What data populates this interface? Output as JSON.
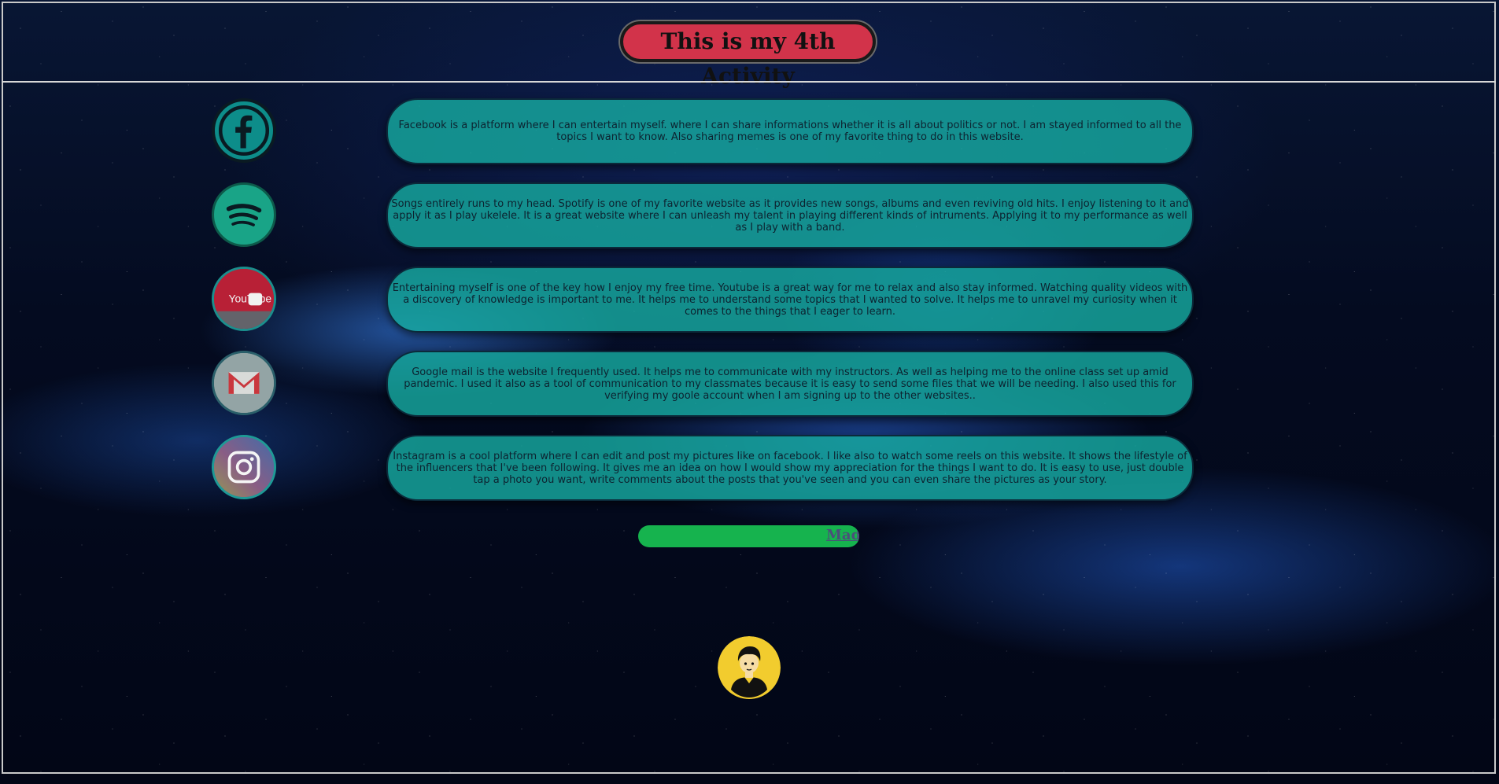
{
  "header": {
    "title": "This is my 4th Activity"
  },
  "sites": [
    {
      "name": "Facebook",
      "icon": "facebook-icon",
      "description": "Facebook is a platform where I can entertain myself. where I can share informations whether it is all about politics or not. I am stayed informed to all the topics I want to know. Also sharing memes is one of my favorite thing to do in this website."
    },
    {
      "name": "Spotify",
      "icon": "spotify-icon",
      "description": "Songs entirely runs to my head. Spotify is one of my favorite website as it provides new songs, albums and even reviving old hits. I enjoy listening to it and apply it as I play ukelele. It is a great website where I can unleash my talent in playing different kinds of intruments. Applying it to my performance as well as I play with a band."
    },
    {
      "name": "YouTube",
      "icon": "youtube-icon",
      "icon_text": "YouTube",
      "description": "Entertaining myself is one of the key how I enjoy my free time. Youtube is a great way for me to relax and also stay informed. Watching quality videos with a discovery of knowledge is important to me. It helps me to understand some topics that I wanted to solve. It helps me to unravel my curiosity when it comes to the things that I eager to learn."
    },
    {
      "name": "Gmail",
      "icon": "gmail-icon",
      "description": "Google mail is the website I frequently used. It helps me to communicate with my instructors. As well as helping me to the online class set up amid pandemic. I used it also as a tool of communication to my classmates because it is easy to send some files that we will be needing. I also used this for verifying my goole account when I am signing up to the other websites.."
    },
    {
      "name": "Instagram",
      "icon": "instagram-icon",
      "description": "Instagram is a cool platform where I can edit and post my pictures like on facebook. I like also to watch some reels on this website. It shows the lifestyle of the influencers that I've been following. It gives me an idea on how I would show my appreciation for the things I want to do. It is easy to use, just double tap a photo you want, write comments about the posts that you've seen and you can even share the pictures as your story."
    }
  ],
  "footer": {
    "marquee_text": "Made",
    "avatar_icon": "user-avatar-icon"
  },
  "colors": {
    "title_bg": "#d2334a",
    "card_bg": "#16aaa0",
    "marquee_bg": "#16b34e",
    "avatar_bg": "#f2cc2e"
  }
}
